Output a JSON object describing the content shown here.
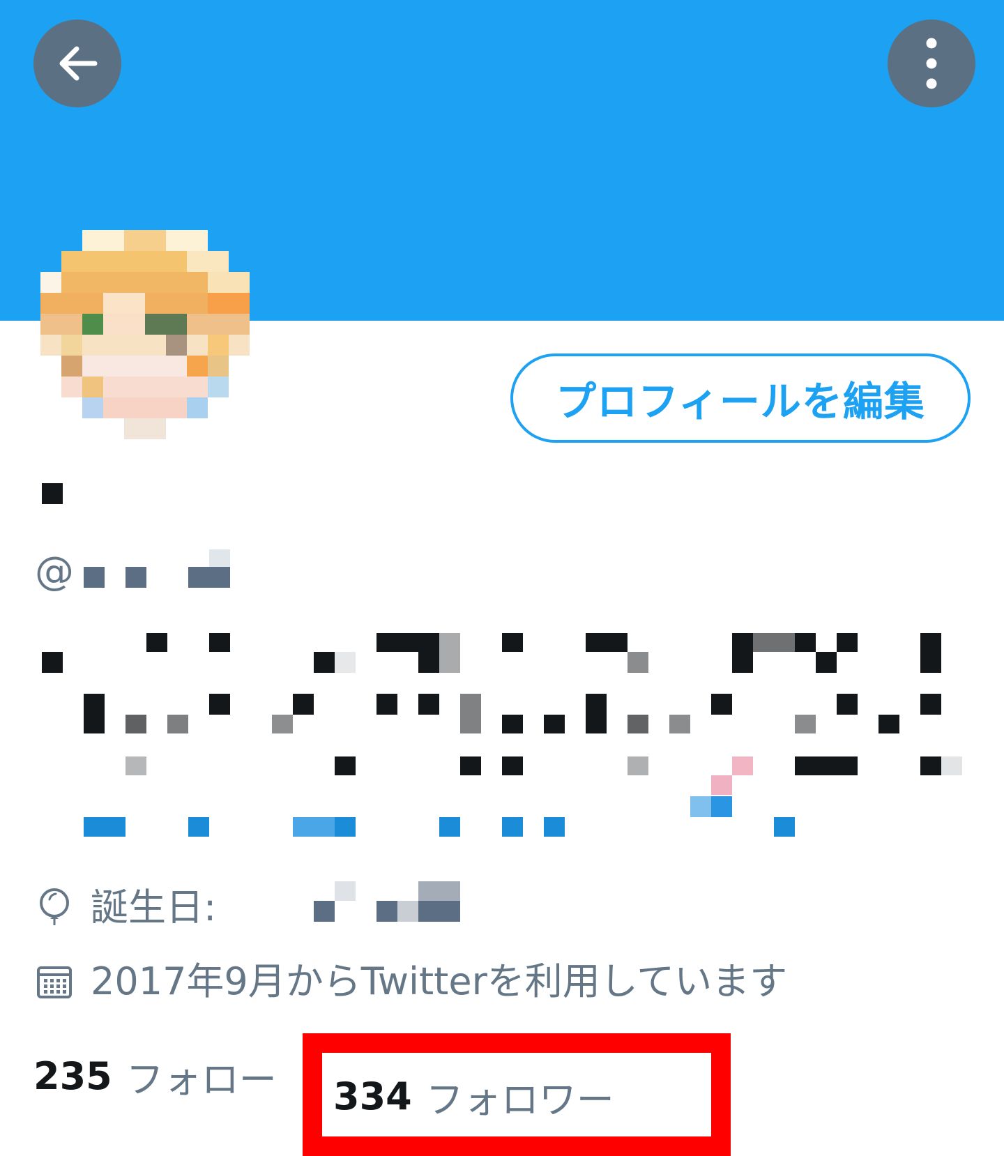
{
  "colors": {
    "banner": "#1da1f2",
    "nav_button": "#5b7083",
    "accent": "#1da1f2",
    "secondary_text": "#657786",
    "primary_text": "#14171a",
    "annotation": "#ff0000"
  },
  "header": {
    "back_icon": "arrow-left-icon",
    "more_icon": "more-vertical-icon"
  },
  "profile": {
    "edit_button_label": "プロフィールを編集",
    "handle_prefix": "@",
    "birthday_label": "誕生日:",
    "joined_text": "2017年9月からTwitterを利用しています"
  },
  "stats": {
    "following_count": "235",
    "following_label": "フォロー",
    "followers_count": "334",
    "followers_label": "フォロワー"
  }
}
